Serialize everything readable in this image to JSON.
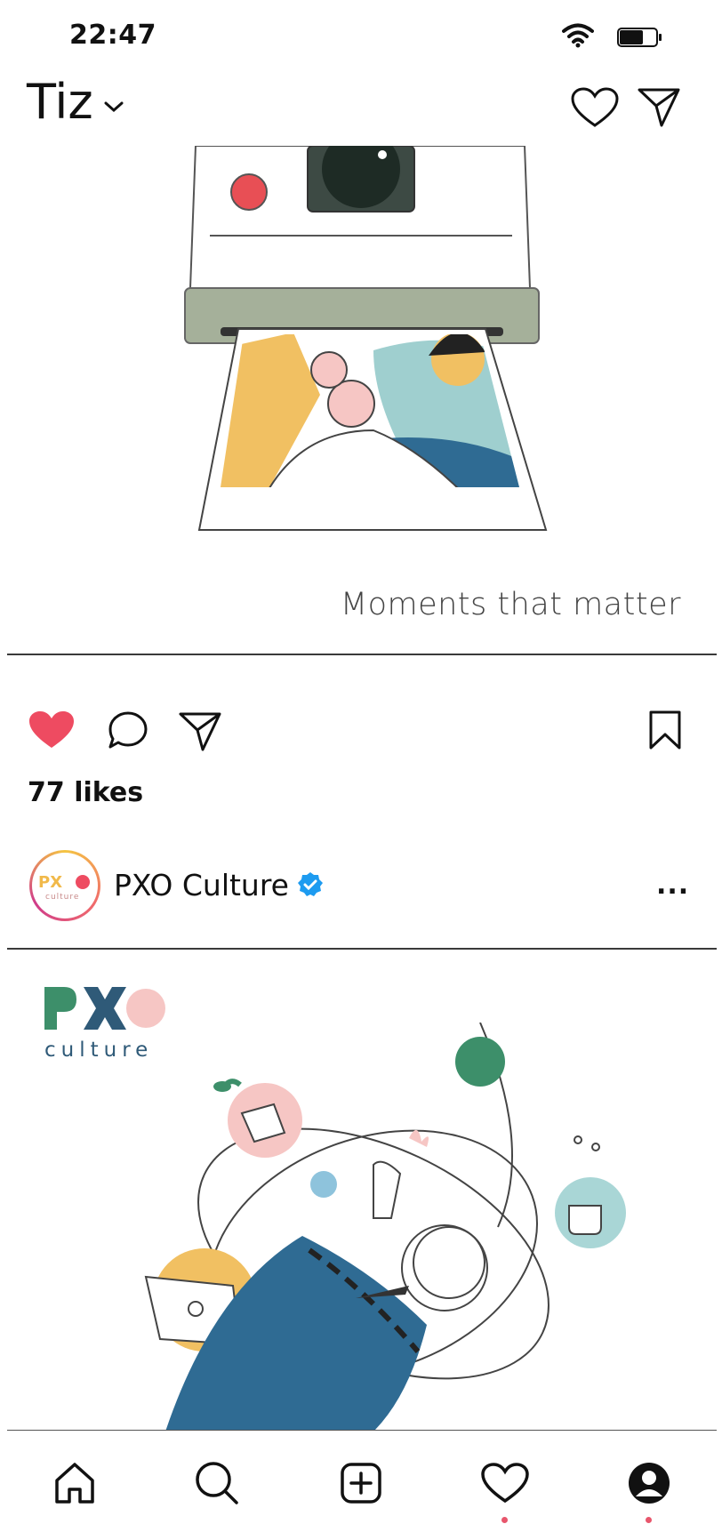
{
  "status_bar": {
    "time": "22:47"
  },
  "header": {
    "account_name": "Tiz"
  },
  "post1": {
    "caption": "Moments that matter",
    "likes": "77 likes"
  },
  "post2": {
    "username": "PXO Culture",
    "more": "...",
    "brand_sub": "culture"
  },
  "colors": {
    "accent_red": "#ee4b61",
    "brand_green": "#3d8f6a",
    "brand_blue": "#2f5a78",
    "brand_pink": "#f6c6c4",
    "verified_blue": "#1d9bf0"
  },
  "nav": {
    "items": [
      "home-icon",
      "search-icon",
      "add-post-icon",
      "activity-icon",
      "profile-icon"
    ]
  }
}
